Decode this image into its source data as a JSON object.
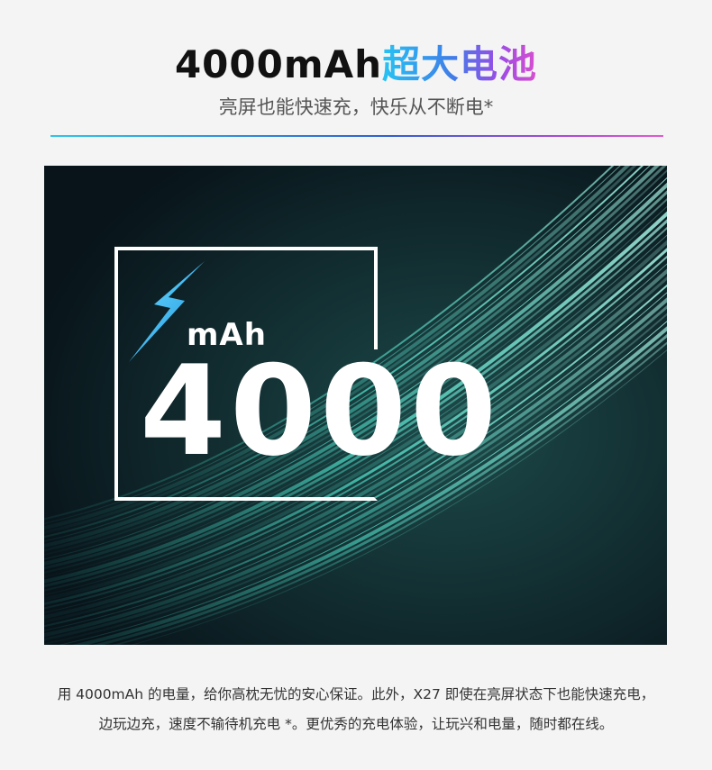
{
  "header": {
    "title_black": "4000mAh",
    "title_gradient": "超大电池",
    "subtitle": "亮屏也能快速充，快乐从不断电*"
  },
  "hero": {
    "unit": "mAh",
    "capacity": "4000"
  },
  "description": {
    "line1": "用 4000mAh 的电量，给你高枕无忧的安心保证。此外，X27 即使在亮屏状态下也能快速充电，",
    "line2": "边玩边充，速度不输待机充电 *。更优秀的充电体验，让玩兴和电量，随时都在线。"
  },
  "colors": {
    "gradient_start": "#27c3f3",
    "gradient_end": "#d84fcf",
    "hero_background": "#0b171b",
    "wave_accent": "#4fe0c9"
  },
  "icons": {
    "bolt": "lightning-bolt-icon"
  }
}
